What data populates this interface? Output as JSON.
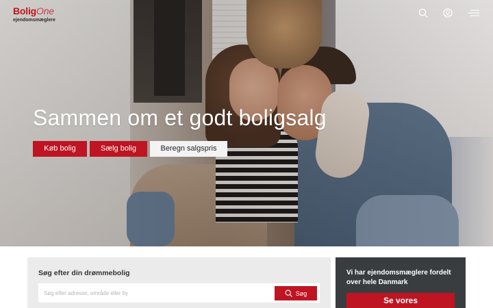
{
  "header": {
    "logo": {
      "bolig": "Bolig",
      "one": "One",
      "subtitle": "ejendomsmæglere"
    },
    "icons": [
      "search-icon",
      "user-icon",
      "menu-icon"
    ]
  },
  "hero": {
    "title": "Sammen om et godt boligsalg",
    "buttons": {
      "buy": "Køb bolig",
      "sell": "Sælg bolig",
      "valuation": "Beregn salgspris"
    }
  },
  "search": {
    "title": "Søg efter din drømmebolig",
    "placeholder": "Søg efter adresse, område eller by",
    "button": "Søg"
  },
  "agents": {
    "text": "Vi har ejendomsmæglere fordelt over hele Danmark",
    "button": "Se vores"
  },
  "colors": {
    "brand_red": "#bf1422",
    "panel_dark": "#3a3d40",
    "panel_light": "#ebebeb"
  }
}
